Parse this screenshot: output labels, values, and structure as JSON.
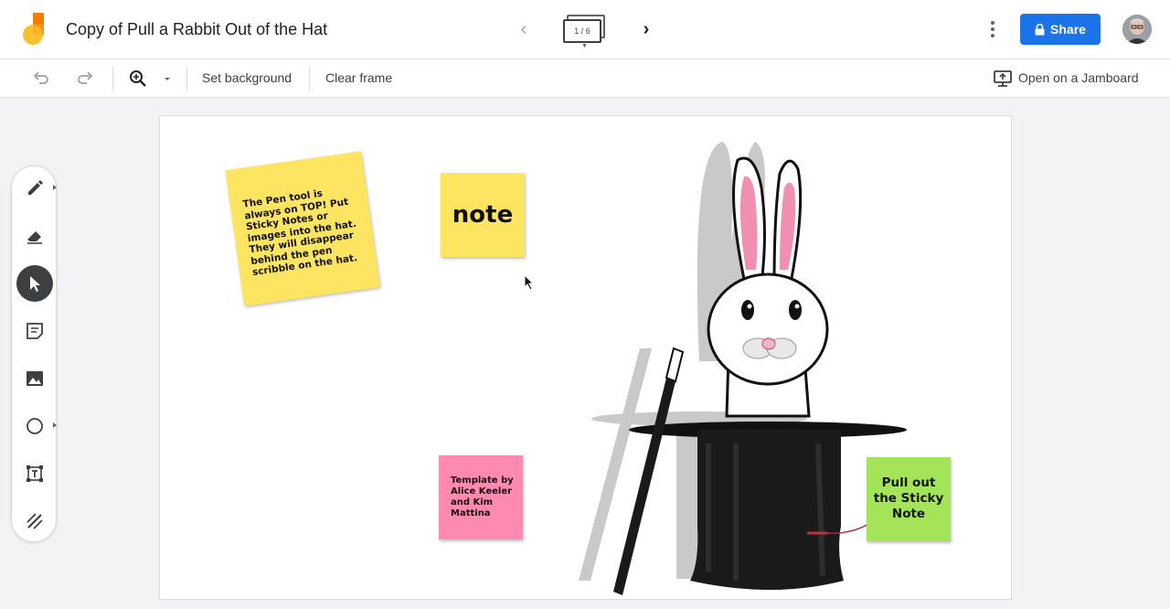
{
  "header": {
    "doc_title": "Copy of Pull a Rabbit Out of the Hat",
    "frame_counter": "1 / 6",
    "share_label": "Share",
    "icons": [
      "jamboard-logo-icon",
      "chevron-left-icon",
      "frame-bar-icon",
      "chevron-right-icon",
      "more-vert-icon",
      "lock-icon",
      "avatar"
    ]
  },
  "toolbar": {
    "set_background": "Set background",
    "clear_frame": "Clear frame",
    "open_on_jamboard": "Open on a Jamboard",
    "icons": [
      "undo-icon",
      "redo-icon",
      "zoom-icon",
      "dropdown-icon",
      "jamboard-device-icon"
    ]
  },
  "rail": {
    "tools": [
      "pen-tool",
      "eraser-tool",
      "select-tool",
      "sticky-note-tool",
      "image-tool",
      "shape-tool",
      "text-box-tool",
      "laser-tool"
    ],
    "active": "select-tool"
  },
  "canvas": {
    "sticky_instructions": "The Pen tool is always on TOP! Put Sticky Notes or images into the hat. They will disappear behind the pen scribble on the hat.",
    "sticky_note": "note",
    "sticky_credit": "Template by Alice Keeler and Kim Mattina",
    "sticky_pull": "Pull out the Sticky Note"
  },
  "colors": {
    "share_blue": "#1a73e8",
    "sticky_yellow": "#fde561",
    "sticky_pink": "#ff8aaf",
    "sticky_green": "#a4e458",
    "active_tool": "#3c4043"
  }
}
